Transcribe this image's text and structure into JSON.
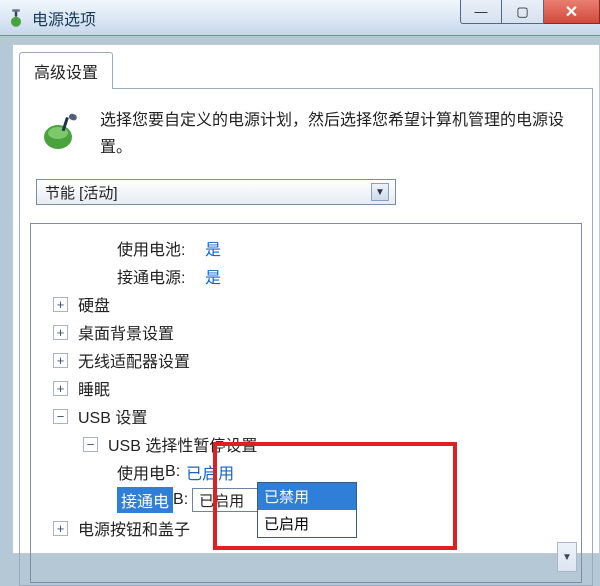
{
  "window": {
    "title": "电源选项"
  },
  "tab": {
    "label": "高级设置"
  },
  "intro": {
    "text": "选择您要自定义的电源计划，然后选择您希望计算机管理的电源设置。"
  },
  "plan_combo": {
    "value": "节能 [活动]"
  },
  "tree": {
    "top_battery_label": "使用电池:",
    "top_battery_value": "是",
    "top_ac_label": "接通电源:",
    "top_ac_value": "是",
    "hdd": "硬盘",
    "desktop_bg": "桌面背景设置",
    "wireless": "无线适配器设置",
    "sleep": "睡眠",
    "usb": "USB 设置",
    "usb_suspend": "USB 选择性暂停设置",
    "usb_battery_label": "使用电",
    "usb_battery_label_hidden_tail": "B:",
    "usb_battery_value": "已启用",
    "usb_ac_label": "接通电",
    "usb_ac_label_hidden_tail": "B:",
    "usb_ac_value": "已启用",
    "power_button": "电源按钮和盖子"
  },
  "dropdown": {
    "opt_disabled": "已禁用",
    "opt_enabled": "已启用"
  },
  "win_buttons": {
    "min": "—",
    "max": "▢",
    "close": "✕"
  }
}
